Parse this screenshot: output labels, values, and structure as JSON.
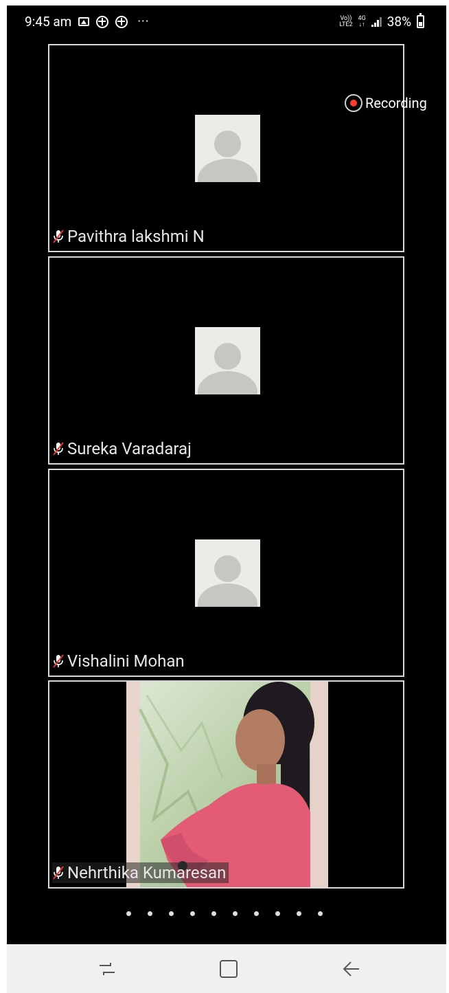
{
  "status_bar": {
    "time": "9:45 am",
    "more": "···",
    "network_top": "Vo))",
    "network_bottom": "LTE2",
    "network_type_top": "4G",
    "network_type_bottom": "↓↑",
    "battery": "38%",
    "icons": [
      "gallery-icon",
      "plus-circle-icon",
      "plus-circle-icon",
      "more-icon",
      "signal-icon",
      "battery-icon"
    ]
  },
  "recording": {
    "label": "Recording",
    "color": "#ff3b30"
  },
  "participants": [
    {
      "name": "Pavithra lakshmi N",
      "muted": true,
      "has_video": false
    },
    {
      "name": "Sureka Varadaraj",
      "muted": true,
      "has_video": false
    },
    {
      "name": "Vishalini Mohan",
      "muted": true,
      "has_video": false
    },
    {
      "name": "Nehrthika Kumaresan",
      "muted": true,
      "has_video": true
    }
  ],
  "pagination": {
    "total_pages": 10,
    "current_page": 1
  },
  "nav_bar": {
    "icons": [
      "recent-apps-icon",
      "home-icon",
      "back-icon"
    ]
  }
}
